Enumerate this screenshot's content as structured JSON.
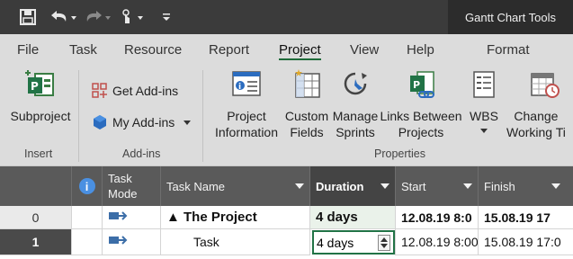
{
  "titlebar": {
    "tools_title": "Gantt Chart Tools",
    "qat_icons": [
      "save-icon",
      "undo-icon",
      "redo-icon",
      "touch-mode-icon",
      "customize-qat-icon"
    ]
  },
  "tabs": [
    "File",
    "Task",
    "Resource",
    "Report",
    "Project",
    "View",
    "Help",
    "Format"
  ],
  "active_tab": "Project",
  "ribbon": {
    "insert": {
      "group": "Insert",
      "subproject": "Subproject"
    },
    "addins": {
      "group": "Add-ins",
      "get_addins": "Get Add-ins",
      "my_addins": "My Add-ins"
    },
    "properties": {
      "group": "Properties",
      "project_information": "Project\nInformation",
      "custom_fields": "Custom\nFields",
      "manage_sprints": "Manage\nSprints",
      "links_between_projects": "Links Between\nProjects",
      "wbs": "WBS",
      "change_working_time": "Change\nWorking Ti"
    }
  },
  "grid": {
    "headers": {
      "info": "i",
      "task_mode": "Task\nMode",
      "task_name": "Task Name",
      "duration": "Duration",
      "start": "Start",
      "finish": "Finish"
    },
    "rows": [
      {
        "id": "0",
        "name": "▲ The Project",
        "duration": "4 days",
        "start": "12.08.19 8:0",
        "finish": "15.08.19 17"
      },
      {
        "id": "1",
        "name": "Task",
        "duration": "4 days",
        "start": "12.08.19 8:00",
        "finish": "15.08.19 17:0"
      }
    ]
  },
  "colors": {
    "accent": "#217346",
    "titlebar": "#3b3b3b",
    "ribbon": "#dcdcdc",
    "header": "#5a5a5a"
  }
}
